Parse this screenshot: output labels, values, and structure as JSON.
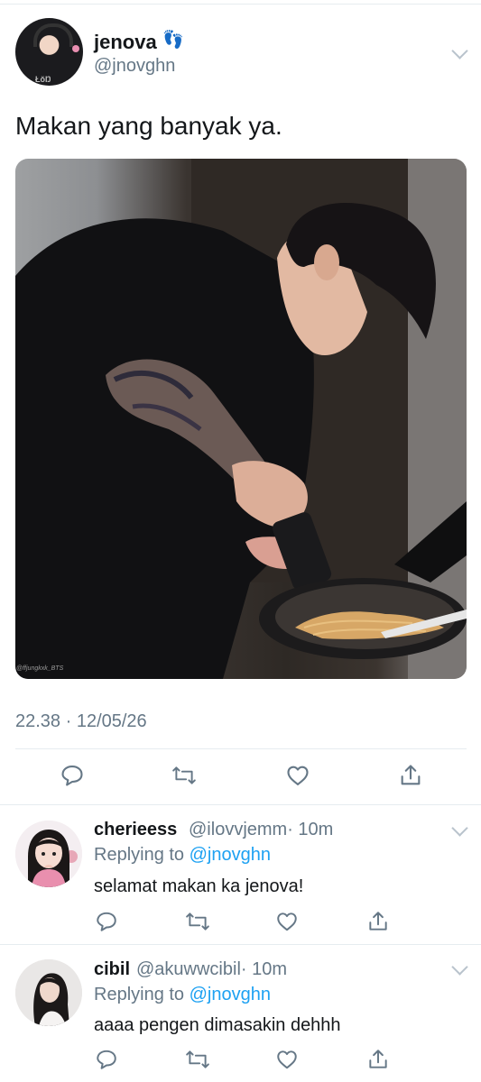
{
  "tweet": {
    "author_name": "jenova",
    "author_emoji": "👣",
    "author_handle": "@jnovghn",
    "text": "Makan yang banyak ya.",
    "timestamp": "22.38 · 12/05/26",
    "photo_watermark": "@ffjungkxk_BTS"
  },
  "replies": [
    {
      "name": "cherieess",
      "handle": "@ilovvjemm",
      "time": "· 10m",
      "replying_prefix": "Replying to ",
      "replying_to": "@jnovghn",
      "text": "selamat makan ka jenova!"
    },
    {
      "name": "cibil",
      "handle": "@akuwwcibil",
      "time": "· 10m",
      "replying_prefix": "Replying to ",
      "replying_to": "@jnovghn",
      "text": "aaaa pengen dimasakin dehhh"
    }
  ],
  "icons": {
    "action_color": "#657786",
    "mention_color": "#1da1f2",
    "items": [
      "reply-icon",
      "retweet-icon",
      "like-icon",
      "share-icon",
      "chevron-down-icon"
    ]
  }
}
